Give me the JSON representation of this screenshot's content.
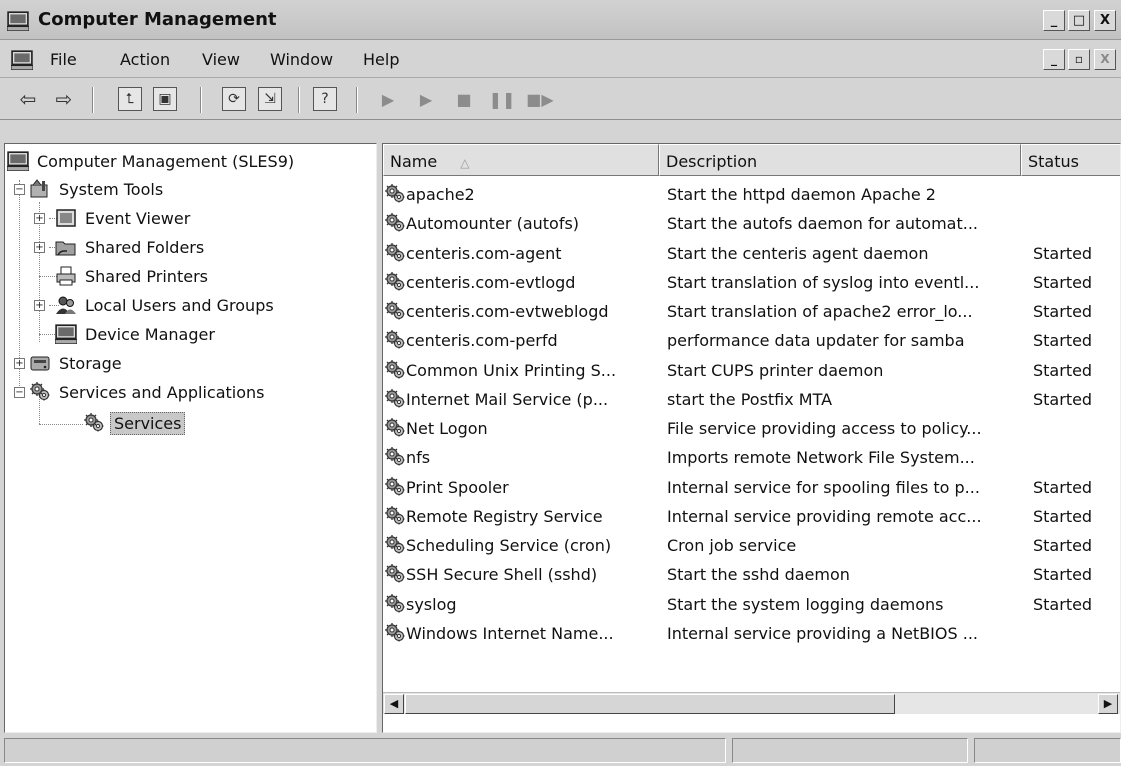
{
  "window": {
    "title": "Computer Management",
    "controls": [
      "_",
      "□",
      "X"
    ]
  },
  "menu": {
    "items": [
      "File",
      "Action",
      "View",
      "Window",
      "Help"
    ],
    "mdi_controls": [
      "_",
      "▫",
      "X"
    ]
  },
  "toolbar": {
    "buttons": [
      "back-icon",
      "forward-icon",
      "up-one-level-icon",
      "show-hide-tree-icon",
      "refresh-icon",
      "export-list-icon",
      "help-icon",
      "start-service-icon",
      "start-service-alt-icon",
      "stop-service-icon",
      "pause-service-icon",
      "restart-service-icon"
    ]
  },
  "tree": {
    "root": "Computer Management (SLES9)",
    "system_tools": "System Tools",
    "event_viewer": "Event Viewer",
    "shared_folders": "Shared Folders",
    "shared_printers": "Shared Printers",
    "local_users": "Local Users and Groups",
    "device_manager": "Device Manager",
    "storage": "Storage",
    "services_apps": "Services and Applications",
    "services": "Services"
  },
  "list": {
    "columns": {
      "name": "Name",
      "description": "Description",
      "status": "Status"
    },
    "rows": [
      {
        "name": "apache2",
        "description": "Start the httpd daemon Apache 2",
        "status": ""
      },
      {
        "name": "Automounter (autofs)",
        "description": "Start the autofs daemon for automat...",
        "status": ""
      },
      {
        "name": "centeris.com-agent",
        "description": "Start the centeris agent daemon",
        "status": "Started"
      },
      {
        "name": "centeris.com-evtlogd",
        "description": "Start translation of syslog into eventl...",
        "status": "Started"
      },
      {
        "name": "centeris.com-evtweblogd",
        "description": "Start translation of apache2 error_lo...",
        "status": "Started"
      },
      {
        "name": "centeris.com-perfd",
        "description": "performance data updater for samba",
        "status": "Started"
      },
      {
        "name": "Common Unix Printing S...",
        "description": "Start CUPS printer daemon",
        "status": "Started"
      },
      {
        "name": "Internet Mail Service (p...",
        "description": "start the Postfix MTA",
        "status": "Started"
      },
      {
        "name": "Net Logon",
        "description": "File service providing access to policy...",
        "status": ""
      },
      {
        "name": "nfs",
        "description": "Imports remote Network File System...",
        "status": ""
      },
      {
        "name": "Print Spooler",
        "description": "Internal service for spooling files to p...",
        "status": "Started"
      },
      {
        "name": "Remote Registry Service",
        "description": "Internal service providing remote acc...",
        "status": "Started"
      },
      {
        "name": "Scheduling Service (cron)",
        "description": "Cron job service",
        "status": "Started"
      },
      {
        "name": "SSH Secure Shell (sshd)",
        "description": "Start the sshd daemon",
        "status": "Started"
      },
      {
        "name": "syslog",
        "description": "Start the system logging daemons",
        "status": "Started"
      },
      {
        "name": "Windows Internet Name...",
        "description": "Internal service providing a NetBIOS ...",
        "status": ""
      }
    ]
  },
  "colors": {
    "chrome": "#d4d4d4",
    "pane": "#ffffff",
    "selection": "#c8c8c8"
  }
}
